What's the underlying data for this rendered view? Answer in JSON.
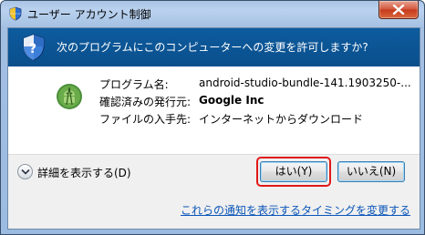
{
  "window": {
    "title": "ユーザー アカウント制御"
  },
  "header": {
    "question": "次のプログラムにこのコンピューターへの変更を許可しますか?"
  },
  "details": {
    "program_label": "プログラム名:",
    "program_value": "android-studio-bundle-141.1903250-...",
    "publisher_label": "確認済みの発行元:",
    "publisher_value": "Google Inc",
    "origin_label": "ファイルの入手先:",
    "origin_value": "インターネットからダウンロード"
  },
  "footer": {
    "show_details": "詳細を表示する(D)",
    "yes_button": "はい(Y)",
    "no_button": "いいえ(N)",
    "settings_link": "これらの通知を表示するタイミングを変更する"
  },
  "colors": {
    "header_bg": "#0b5597",
    "highlight": "#e01818",
    "link": "#0a55b8"
  },
  "icons": {
    "title": "uac-shield-icon",
    "header": "uac-shield-icon",
    "app": "android-studio-icon",
    "close": "close-icon",
    "toggle": "chevron-down-icon"
  }
}
